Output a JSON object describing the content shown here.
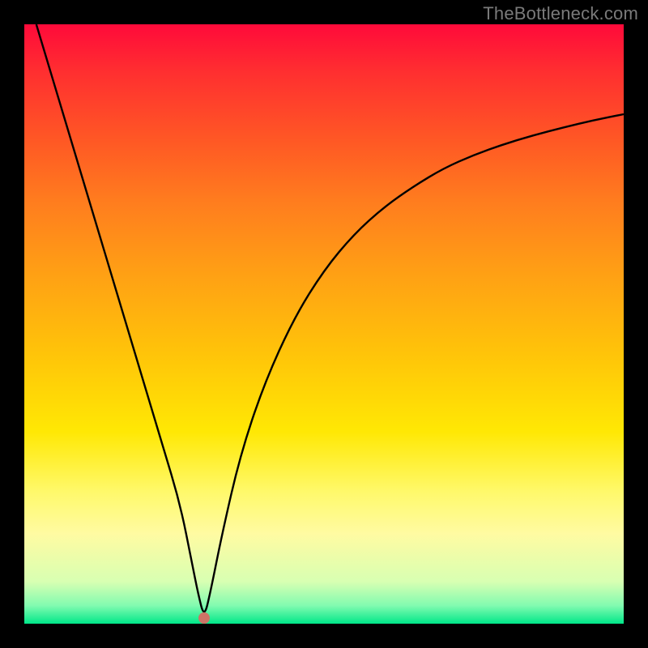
{
  "watermark": "TheBottleneck.com",
  "colors": {
    "frame_bg_top": "#ff0a3a",
    "frame_bg_bottom": "#00e789",
    "curve_stroke": "#000000",
    "dot_fill": "#cd7366",
    "page_bg": "#000000",
    "watermark_color": "#7a7a7a"
  },
  "chart_data": {
    "type": "line",
    "title": "",
    "xlabel": "",
    "ylabel": "",
    "xlim": [
      0,
      100
    ],
    "ylim": [
      0,
      100
    ],
    "grid": false,
    "legend": false,
    "series": [
      {
        "name": "bottleneck-curve",
        "x": [
          2,
          5,
          8,
          11,
          14,
          17,
          20,
          23,
          26,
          28,
          29,
          30,
          31,
          33,
          36,
          40,
          45,
          50,
          55,
          60,
          65,
          70,
          75,
          80,
          85,
          90,
          95,
          100
        ],
        "y": [
          100,
          90,
          80,
          70,
          60,
          50,
          40,
          30,
          20,
          10,
          5,
          1,
          5,
          15,
          28,
          40,
          51,
          59,
          65,
          69.5,
          73,
          76,
          78.2,
          80,
          81.5,
          82.8,
          84,
          85
        ]
      }
    ],
    "marker": {
      "x": 30,
      "y": 1
    },
    "annotations": []
  }
}
